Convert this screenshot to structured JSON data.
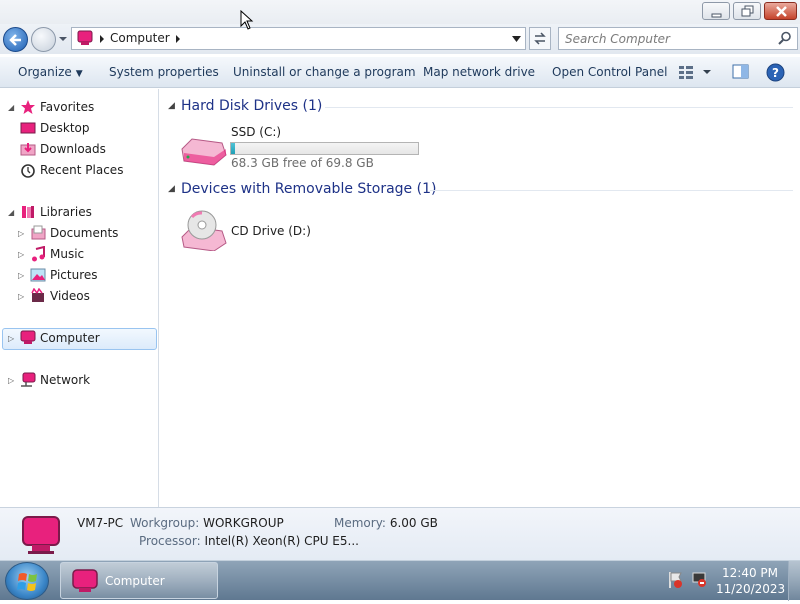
{
  "window": {
    "controls": {
      "minimize": "minimize-icon",
      "restore": "restore-icon",
      "close": "close-icon"
    }
  },
  "address_bar": {
    "breadcrumb": "Computer",
    "search_placeholder": "Search Computer"
  },
  "command_bar": {
    "organize": "Organize",
    "system_properties": "System properties",
    "uninstall": "Uninstall or change a program",
    "map_drive": "Map network drive",
    "control_panel": "Open Control Panel"
  },
  "nav_pane": {
    "favorites": {
      "label": "Favorites",
      "items": [
        "Desktop",
        "Downloads",
        "Recent Places"
      ]
    },
    "libraries": {
      "label": "Libraries",
      "items": [
        "Documents",
        "Music",
        "Pictures",
        "Videos"
      ]
    },
    "computer": "Computer",
    "network": "Network"
  },
  "content": {
    "groups": [
      {
        "title": "Hard Disk Drives (1)",
        "drives": [
          {
            "name": "SSD (C:)",
            "free_text": "68.3 GB free of 69.8 GB",
            "used_fraction": 0.021
          }
        ]
      },
      {
        "title": "Devices with Removable Storage (1)",
        "drives": [
          {
            "name": "CD Drive (D:)"
          }
        ]
      }
    ]
  },
  "details": {
    "computer_name": "VM7-PC",
    "workgroup_label": "Workgroup:",
    "workgroup": "WORKGROUP",
    "memory_label": "Memory:",
    "memory": "6.00 GB",
    "processor_label": "Processor:",
    "processor": "Intel(R) Xeon(R) CPU E5..."
  },
  "taskbar": {
    "task_label": "Computer",
    "time": "12:40 PM",
    "date": "11/20/2023"
  },
  "colors": {
    "accent_pink": "#e8217d",
    "link_blue": "#1e3287",
    "progress": "#26a9be"
  }
}
